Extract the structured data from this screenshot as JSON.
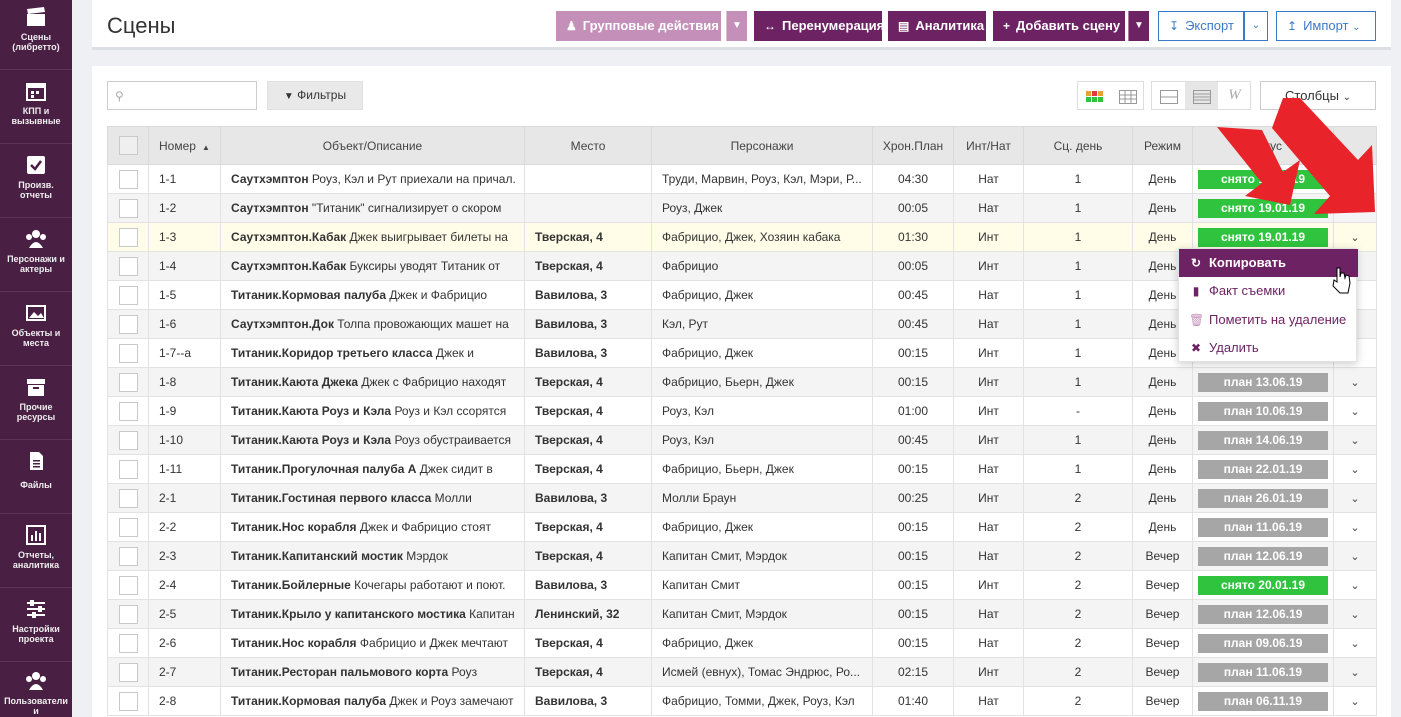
{
  "sidebar": {
    "items": [
      {
        "label": "Сцены (либретто)",
        "icon": "clapperboard-icon"
      },
      {
        "label": "КПП и вызывные",
        "icon": "calendar-icon"
      },
      {
        "label": "Произв. отчеты",
        "icon": "checkbox-icon"
      },
      {
        "label": "Персонажи и актеры",
        "icon": "people-icon"
      },
      {
        "label": "Объекты и места",
        "icon": "image-icon"
      },
      {
        "label": "Прочие ресурсы",
        "icon": "archive-icon"
      },
      {
        "label": "Файлы",
        "icon": "file-icon"
      },
      {
        "label": "Отчеты, аналитика",
        "icon": "bar-chart-icon"
      },
      {
        "label": "Настройки проекта",
        "icon": "sliders-icon"
      },
      {
        "label": "Пользователи и",
        "icon": "users-icon"
      }
    ]
  },
  "header": {
    "title": "Сцены",
    "group_actions": "Групповые действия",
    "renumber": "Перенумерация",
    "analytics": "Аналитика",
    "add_scene": "Добавить сцену",
    "export": "Экспорт",
    "import": "Импорт"
  },
  "toolbar": {
    "search_placeholder": "",
    "filters": "Фильтры",
    "columns": "Столбцы"
  },
  "table": {
    "columns": [
      "Номер",
      "Объект/Описание",
      "Место",
      "Персонажи",
      "Хрон.План",
      "Инт/Нат",
      "Сц. день",
      "Режим",
      "Статус"
    ],
    "rows": [
      {
        "num": "1-1",
        "obj": "Саутхэмптон",
        "desc": " Роуз, Кэл и Рут приехали на причал.",
        "place": "",
        "chars": "Труди, Марвин, Роуз, Кэл, Мэри, Р...",
        "time": "04:30",
        "intnat": "Нат",
        "day": "1",
        "mode": "День",
        "status": "снято 19.01.19",
        "status_color": "green"
      },
      {
        "num": "1-2",
        "obj": "Саутхэмптон",
        "desc": " \"Титаник\" сигнализирует о скором",
        "place": "",
        "chars": "Роуз, Джек",
        "time": "00:05",
        "intnat": "Нат",
        "day": "1",
        "mode": "День",
        "status": "снято 19.01.19",
        "status_color": "green"
      },
      {
        "num": "1-3",
        "obj": "Саутхэмптон.Кабак",
        "desc": " Джек выигрывает билеты на",
        "place": "Тверская, 4",
        "chars": "Фабрицио, Джек, Хозяин кабака",
        "time": "01:30",
        "intnat": "Инт",
        "day": "1",
        "mode": "День",
        "status": "снято 19.01.19",
        "status_color": "green"
      },
      {
        "num": "1-4",
        "obj": "Саутхэмптон.Кабак",
        "desc": " Буксиры уводят Титаник от",
        "place": "Тверская, 4",
        "chars": "Фабрицио",
        "time": "00:05",
        "intnat": "Инт",
        "day": "1",
        "mode": "День",
        "status": "",
        "status_color": ""
      },
      {
        "num": "1-5",
        "obj": "Титаник.Кормовая палуба",
        "desc": " Джек и Фабрицио",
        "place": "Вавилова, 3",
        "chars": "Фабрицио, Джек",
        "time": "00:45",
        "intnat": "Нат",
        "day": "1",
        "mode": "День",
        "status": "",
        "status_color": ""
      },
      {
        "num": "1-6",
        "obj": "Саутхэмптон.Док",
        "desc": " Толпа провожающих машет на",
        "place": "Вавилова, 3",
        "chars": "Кэл, Рут",
        "time": "00:45",
        "intnat": "Нат",
        "day": "1",
        "mode": "День",
        "status": "",
        "status_color": ""
      },
      {
        "num": "1-7--а",
        "obj": "Титаник.Коридор третьего класса",
        "desc": " Джек и",
        "place": "Вавилова, 3",
        "chars": "Фабрицио, Джек",
        "time": "00:15",
        "intnat": "Инт",
        "day": "1",
        "mode": "День",
        "status": "",
        "status_color": ""
      },
      {
        "num": "1-8",
        "obj": "Титаник.Каюта Джека",
        "desc": " Джек с Фабрицио находят",
        "place": "Тверская, 4",
        "chars": "Фабрицио, Бьерн, Джек",
        "time": "00:15",
        "intnat": "Инт",
        "day": "1",
        "mode": "День",
        "status": "план 13.06.19",
        "status_color": "gray"
      },
      {
        "num": "1-9",
        "obj": "Титаник.Каюта Роуз и Кэла",
        "desc": " Роуз и Кэл ссорятся",
        "place": "Тверская, 4",
        "chars": "Роуз, Кэл",
        "time": "01:00",
        "intnat": "Инт",
        "day": "-",
        "mode": "День",
        "status": "план 10.06.19",
        "status_color": "gray"
      },
      {
        "num": "1-10",
        "obj": "Титаник.Каюта Роуз и Кэла",
        "desc": " Роуз обустраивается",
        "place": "Тверская, 4",
        "chars": "Роуз, Кэл",
        "time": "00:45",
        "intnat": "Инт",
        "day": "1",
        "mode": "День",
        "status": "план 14.06.19",
        "status_color": "gray"
      },
      {
        "num": "1-11",
        "obj": "Титаник.Прогулочная палуба А",
        "desc": " Джек сидит в",
        "place": "Тверская, 4",
        "chars": "Фабрицио, Бьерн, Джек",
        "time": "00:15",
        "intnat": "Нат",
        "day": "1",
        "mode": "День",
        "status": "план 22.01.19",
        "status_color": "gray"
      },
      {
        "num": "2-1",
        "obj": "Титаник.Гостиная первого класса",
        "desc": " Молли",
        "place": "Вавилова, 3",
        "chars": "Молли Браун",
        "time": "00:25",
        "intnat": "Инт",
        "day": "2",
        "mode": "День",
        "status": "план 26.01.19",
        "status_color": "gray"
      },
      {
        "num": "2-2",
        "obj": "Титаник.Нос корабля",
        "desc": " Джек и Фабрицио стоят",
        "place": "Тверская, 4",
        "chars": "Фабрицио, Джек",
        "time": "00:15",
        "intnat": "Нат",
        "day": "2",
        "mode": "День",
        "status": "план 11.06.19",
        "status_color": "gray"
      },
      {
        "num": "2-3",
        "obj": "Титаник.Капитанский мостик",
        "desc": " Мэрдок",
        "place": "Тверская, 4",
        "chars": "Капитан Смит, Мэрдок",
        "time": "00:15",
        "intnat": "Нат",
        "day": "2",
        "mode": "Вечер",
        "status": "план 12.06.19",
        "status_color": "gray"
      },
      {
        "num": "2-4",
        "obj": "Титаник.Бойлерные",
        "desc": " Кочегары работают и поют.",
        "place": "Вавилова, 3",
        "chars": "Капитан Смит",
        "time": "00:15",
        "intnat": "Инт",
        "day": "2",
        "mode": "Вечер",
        "status": "снято 20.01.19",
        "status_color": "green"
      },
      {
        "num": "2-5",
        "obj": "Титаник.Крыло у капитанского мостика",
        "desc": " Капитан",
        "place": "Ленинский, 32",
        "chars": "Капитан Смит, Мэрдок",
        "time": "00:15",
        "intnat": "Нат",
        "day": "2",
        "mode": "Вечер",
        "status": "план 12.06.19",
        "status_color": "gray"
      },
      {
        "num": "2-6",
        "obj": "Титаник.Нос корабля",
        "desc": " Фабрицио и Джек мечтают",
        "place": "Тверская, 4",
        "chars": "Фабрицио, Джек",
        "time": "00:15",
        "intnat": "Нат",
        "day": "2",
        "mode": "Вечер",
        "status": "план 09.06.19",
        "status_color": "gray"
      },
      {
        "num": "2-7",
        "obj": "Титаник.Ресторан пальмового корта",
        "desc": " Роуз",
        "place": "Тверская, 4",
        "chars": "Исмей (евнух), Томас Эндрюс, Ро...",
        "time": "02:15",
        "intnat": "Инт",
        "day": "2",
        "mode": "Вечер",
        "status": "план 11.06.19",
        "status_color": "gray"
      },
      {
        "num": "2-8",
        "obj": "Титаник.Кормовая палуба",
        "desc": " Джек и Роуз замечают",
        "place": "Вавилова, 3",
        "chars": "Фабрицио, Томми, Джек, Роуз, Кэл",
        "time": "01:40",
        "intnat": "Нат",
        "day": "2",
        "mode": "Вечер",
        "status": "план 06.11.19",
        "status_color": "gray"
      }
    ]
  },
  "context_menu": {
    "items": [
      {
        "label": "Копировать",
        "icon": "refresh-icon"
      },
      {
        "label": "Факт съемки",
        "icon": "book-icon"
      },
      {
        "label": "Пометить на удаление",
        "icon": "trash-icon"
      },
      {
        "label": "Удалить",
        "icon": "x-icon"
      }
    ]
  },
  "colors": {
    "sidebar": "#4a1f44",
    "accent": "#6d2363",
    "status_green": "#2fc33e",
    "status_gray": "#a6a6a6",
    "arrow_red": "#e8242a"
  }
}
